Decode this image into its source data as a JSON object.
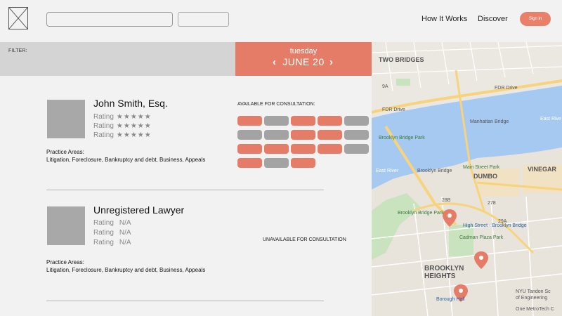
{
  "header": {
    "nav": [
      "How It Works",
      "Discover"
    ],
    "signin_label": "Sign in"
  },
  "filter": {
    "label": "FILTER:"
  },
  "date": {
    "day": "tuesday",
    "date": "JUNE 20"
  },
  "lawyers": [
    {
      "name": "John Smith, Esq.",
      "ratings": [
        {
          "label": "Rating",
          "stars": "★★★★★"
        },
        {
          "label": "Rating",
          "stars": "★★★★★"
        },
        {
          "label": "Rating",
          "stars": "★★★★★"
        }
      ],
      "practice_label": "Practice Areas:",
      "practice_areas": "Litigation, Foreclosure, Bankruptcy and debt, Business, Appeals",
      "availability_label": "AVAILABLE FOR CONSULTATION:",
      "slots": [
        "open",
        "taken",
        "open",
        "open",
        "taken",
        "taken",
        "taken",
        "open",
        "open",
        "taken",
        "open",
        "open",
        "open",
        "open",
        "taken",
        "open",
        "taken",
        "open"
      ]
    },
    {
      "name": "Unregistered Lawyer",
      "ratings": [
        {
          "label": "Rating",
          "value": "N/A"
        },
        {
          "label": "Rating",
          "value": "N/A"
        },
        {
          "label": "Rating",
          "value": "N/A"
        }
      ],
      "practice_label": "Practice Areas:",
      "practice_areas": "Litigation, Foreclosure, Bankruptcy and debt, Business, Appeals",
      "availability_label": "UNAVAILABLE FOR CONSULTATION"
    }
  ],
  "map": {
    "labels": {
      "two_bridges": "TWO BRIDGES",
      "fdr_drive_1": "FDR Drive",
      "fdr_drive_2": "FDR Drive",
      "east_river_1": "East Rive",
      "east_river_2": "East River",
      "main_street_park": "Main Street Park",
      "dumbo": "DUMBO",
      "vinegar": "VINEGAR",
      "brooklyn_bridge": "Brooklyn Bridge",
      "manhattan_bridge": "Manhattan Bridge",
      "brooklyn_bridge_park_1": "Brooklyn Bridge Park",
      "brooklyn_bridge_park_2": "Brooklyn Bridge Park",
      "high_street": "High Street - Brooklyn Bridge",
      "cadman_plaza": "Cadman Plaza Park",
      "brooklyn_heights_1": "BROOKLYN",
      "brooklyn_heights_2": "HEIGHTS",
      "borough_hall": "Borough Hall",
      "nyu_1": "NYU Tandon Sc",
      "nyu_2": "of Engineering",
      "metrotech": "One MetroTech C",
      "route_278": "278",
      "route_9a": "9A",
      "route_28b": "28B",
      "route_29a": "29A"
    },
    "pin_color": "#e57c67",
    "water_color": "#a5c9f1"
  },
  "colors": {
    "accent": "#e57c67",
    "slot_taken": "#a3a3a3",
    "avatar": "#a8a8a8"
  }
}
